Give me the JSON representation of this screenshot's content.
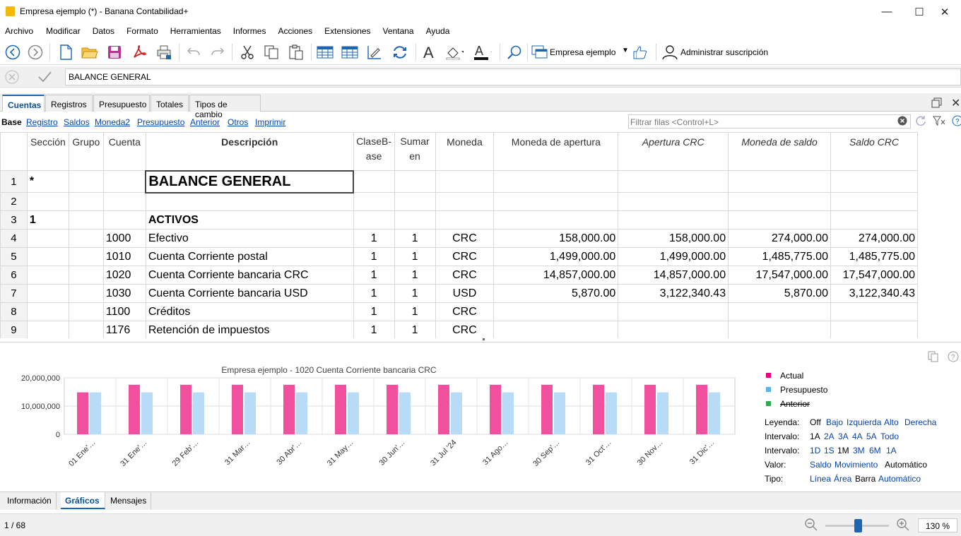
{
  "window": {
    "title": "Empresa ejemplo  (*) - Banana Contabilidad+",
    "min": "—",
    "max": "☐",
    "close": "✕"
  },
  "menu": [
    "Archivo",
    "Modificar",
    "Datos",
    "Formato",
    "Herramientas",
    "Informes",
    "Acciones",
    "Extensiones",
    "Ventana",
    "Ayuda"
  ],
  "toolbar": {
    "company_label": "Empresa ejemplo",
    "subscription_label": "Administrar suscripción"
  },
  "editbar": {
    "value": "BALANCE GENERAL"
  },
  "tabs": [
    "Cuentas",
    "Registros",
    "Presupuesto",
    "Totales",
    "Tipos de cambio"
  ],
  "views": [
    "Base",
    "Registro",
    "Saldos",
    "Moneda2",
    "Presupuesto",
    "Anterior",
    "Otros",
    "Imprimir"
  ],
  "filter": {
    "placeholder": "Filtrar filas <Control+L>"
  },
  "columns": [
    "Sección",
    "Grupo",
    "Cuenta",
    "Descripción",
    "ClaseB-ase",
    "Sumar en",
    "Moneda",
    "Moneda de apertura",
    "Apertura CRC",
    "Moneda de saldo",
    "Saldo CRC"
  ],
  "rows": [
    {
      "n": "1",
      "seccion": "*",
      "grupo": "",
      "cuenta": "",
      "desc": "BALANCE GENERAL",
      "clase": "",
      "sumar": "",
      "moneda": "",
      "mapertura": "",
      "apertura": "",
      "msaldo": "",
      "saldo": ""
    },
    {
      "n": "2",
      "seccion": "",
      "grupo": "",
      "cuenta": "",
      "desc": "",
      "clase": "",
      "sumar": "",
      "moneda": "",
      "mapertura": "",
      "apertura": "",
      "msaldo": "",
      "saldo": ""
    },
    {
      "n": "3",
      "seccion": "1",
      "grupo": "",
      "cuenta": "",
      "desc": "ACTIVOS",
      "clase": "",
      "sumar": "",
      "moneda": "",
      "mapertura": "",
      "apertura": "",
      "msaldo": "",
      "saldo": ""
    },
    {
      "n": "4",
      "seccion": "",
      "grupo": "",
      "cuenta": "1000",
      "desc": "Efectivo",
      "clase": "1",
      "sumar": "1",
      "moneda": "CRC",
      "mapertura": "158,000.00",
      "apertura": "158,000.00",
      "msaldo": "274,000.00",
      "saldo": "274,000.00"
    },
    {
      "n": "5",
      "seccion": "",
      "grupo": "",
      "cuenta": "1010",
      "desc": "Cuenta Corriente postal",
      "clase": "1",
      "sumar": "1",
      "moneda": "CRC",
      "mapertura": "1,499,000.00",
      "apertura": "1,499,000.00",
      "msaldo": "1,485,775.00",
      "saldo": "1,485,775.00"
    },
    {
      "n": "6",
      "seccion": "",
      "grupo": "",
      "cuenta": "1020",
      "desc": "Cuenta Corriente bancaria CRC",
      "clase": "1",
      "sumar": "1",
      "moneda": "CRC",
      "mapertura": "14,857,000.00",
      "apertura": "14,857,000.00",
      "msaldo": "17,547,000.00",
      "saldo": "17,547,000.00"
    },
    {
      "n": "7",
      "seccion": "",
      "grupo": "",
      "cuenta": "1030",
      "desc": "Cuenta Corriente bancaria USD",
      "clase": "1",
      "sumar": "1",
      "moneda": "USD",
      "mapertura": "5,870.00",
      "apertura": "3,122,340.43",
      "msaldo": "5,870.00",
      "saldo": "3,122,340.43"
    },
    {
      "n": "8",
      "seccion": "",
      "grupo": "",
      "cuenta": "1100",
      "desc": "Créditos",
      "clase": "1",
      "sumar": "1",
      "moneda": "CRC",
      "mapertura": "",
      "apertura": "",
      "msaldo": "",
      "saldo": ""
    },
    {
      "n": "9",
      "seccion": "",
      "grupo": "",
      "cuenta": "1176",
      "desc": "Retención de impuestos",
      "clase": "1",
      "sumar": "1",
      "moneda": "CRC",
      "mapertura": "",
      "apertura": "",
      "msaldo": "",
      "saldo": ""
    }
  ],
  "chart_data": {
    "type": "bar",
    "title": "Empresa ejemplo - 1020 Cuenta Corriente bancaria CRC",
    "categories": [
      "01 Ene'…",
      "31 Ene'…",
      "29 Feb'…",
      "31 Mar…",
      "30 Abr'…",
      "31 May…",
      "30 Jun'…",
      "31 Jul '24",
      "31 Ago…",
      "30 Sep'…",
      "31 Oct'…",
      "30 Nov…",
      "31 Dic'…"
    ],
    "series": [
      {
        "name": "Actual",
        "color": "#f0509e",
        "values": [
          14857000,
          17547000,
          17547000,
          17547000,
          17547000,
          17547000,
          17547000,
          17547000,
          17547000,
          17547000,
          17547000,
          17547000,
          17547000
        ]
      },
      {
        "name": "Presupuesto",
        "color": "#b8dcf8",
        "values": [
          14857000,
          14857000,
          14857000,
          14857000,
          14857000,
          14857000,
          14857000,
          14857000,
          14857000,
          14857000,
          14857000,
          14857000,
          14857000
        ]
      }
    ],
    "yticks": [
      "20,000,000",
      "10,000,000",
      "0"
    ],
    "ylim": [
      0,
      20000000
    ]
  },
  "legend": [
    {
      "name": "Actual",
      "color": "#e6007e",
      "strike": false
    },
    {
      "name": "Presupuesto",
      "color": "#5ab4ec",
      "strike": false
    },
    {
      "name": "Anterior",
      "color": "#2fa84f",
      "strike": true
    }
  ],
  "options": {
    "leyenda": {
      "label": "Leyenda:",
      "items": [
        "Off",
        "Bajo",
        "Izquierda",
        "Alto",
        "Derecha"
      ]
    },
    "intervalo1": {
      "label": "Intervalo:",
      "items": [
        "1A",
        "2A",
        "3A",
        "4A",
        "5A",
        "Todo"
      ]
    },
    "intervalo2": {
      "label": "Intervalo:",
      "items": [
        "1D",
        "1S",
        "1M",
        "3M",
        "6M",
        "1A"
      ]
    },
    "valor": {
      "label": "Valor:",
      "items": [
        "Saldo",
        "Movimiento",
        "Automático"
      ]
    },
    "tipo": {
      "label": "Tipo:",
      "items": [
        "Línea",
        "Área",
        "Barra",
        "Automático"
      ]
    }
  },
  "bottom_tabs": [
    "Información",
    "Gráficos",
    "Mensajes"
  ],
  "status": {
    "position": "1 / 68",
    "zoom": "130 %",
    "zoom_level": 0.45
  }
}
